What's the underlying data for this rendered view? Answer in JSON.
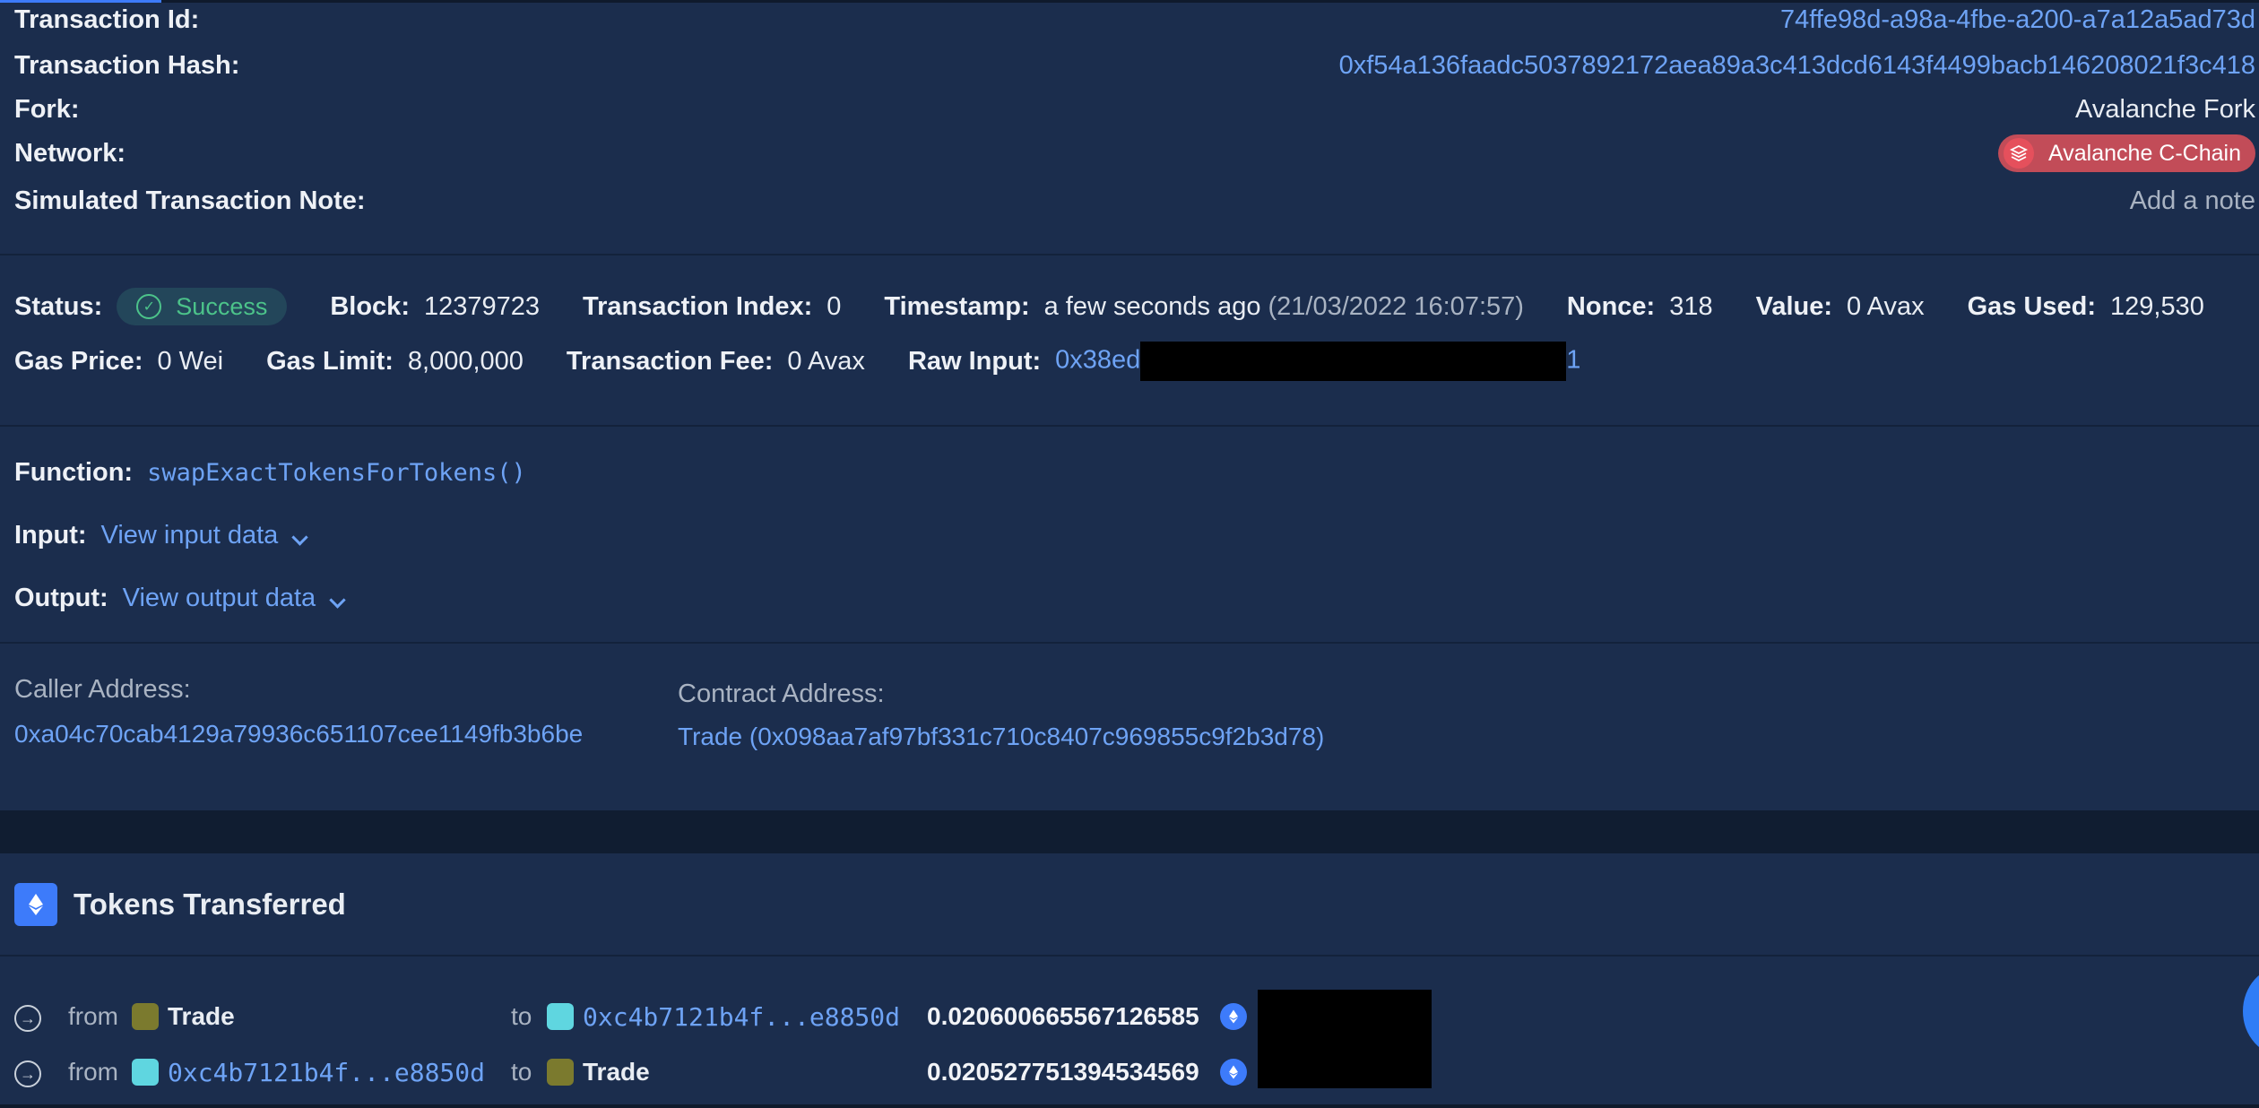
{
  "overview": {
    "transaction_id_label": "Transaction Id:",
    "transaction_id": "74ffe98d-a98a-4fbe-a200-a7a12a5ad73d",
    "transaction_hash_label": "Transaction Hash:",
    "transaction_hash": "0xf54a136faadc5037892172aea89a3c413dcd6143f4499bacb146208021f3c418",
    "fork_label": "Fork:",
    "fork": "Avalanche Fork",
    "network_label": "Network:",
    "network": "Avalanche C-Chain",
    "note_label": "Simulated Transaction Note:",
    "note_placeholder": "Add a note"
  },
  "stats": {
    "status_label": "Status:",
    "status": "Success",
    "block_label": "Block:",
    "block": "12379723",
    "tx_index_label": "Transaction Index:",
    "tx_index": "0",
    "timestamp_label": "Timestamp:",
    "timestamp_relative": "a few seconds ago",
    "timestamp_absolute": "(21/03/2022 16:07:57)",
    "nonce_label": "Nonce:",
    "nonce": "318",
    "value_label": "Value:",
    "value": "0 Avax",
    "gas_used_label": "Gas Used:",
    "gas_used": "129,530",
    "gas_price_label": "Gas Price:",
    "gas_price": "0 Wei",
    "gas_limit_label": "Gas Limit:",
    "gas_limit": "8,000,000",
    "tx_fee_label": "Transaction Fee:",
    "tx_fee": "0 Avax",
    "raw_input_label": "Raw Input:",
    "raw_input_prefix": "0x38ed",
    "raw_input_suffix": "1"
  },
  "function": {
    "function_label": "Function:",
    "function_name": "swapExactTokensForTokens()",
    "input_label": "Input:",
    "input_link": "View input data",
    "output_label": "Output:",
    "output_link": "View output data"
  },
  "addresses": {
    "caller_label": "Caller Address:",
    "caller": "0xa04c70cab4129a79936c651107cee1149fb3b6be",
    "contract_label": "Contract Address:",
    "contract": "Trade (0x098aa7af97bf331c710c8407c969855c9f2b3d78)"
  },
  "tokens": {
    "title": "Tokens Transferred",
    "transfers": [
      {
        "from_word": "from",
        "from": "Trade",
        "to_word": "to",
        "to": "0xc4b7121b4f...e8850d",
        "amount": "0.020600665567126585"
      },
      {
        "from_word": "from",
        "from": "0xc4b7121b4f...e8850d",
        "to_word": "to",
        "to": "Trade",
        "amount": "0.020527751394534569"
      }
    ]
  },
  "colors": {
    "background": "#1b2d4d",
    "link": "#6ea3f5",
    "success": "#4cc38a",
    "network_badge": "#c24c58",
    "accent": "#3d7bfa"
  }
}
